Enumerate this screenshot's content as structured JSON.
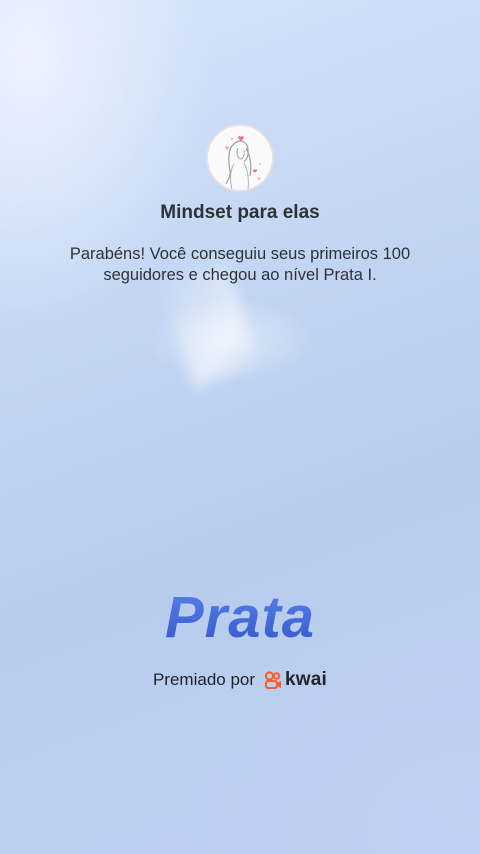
{
  "profile": {
    "name": "Mindset para elas",
    "avatar_icon": "woman-sketch-avatar-icon"
  },
  "message": "Parabéns! Você conseguiu seus primeiros 100 seguidores e chegou ao nível Prata I.",
  "level": {
    "name": "Prata",
    "color": "#3f66d6"
  },
  "awarded": {
    "label": "Premiado por",
    "brand_name": "kwai",
    "brand_icon": "kwai-logo-icon",
    "brand_color": "#ff5a1f"
  },
  "colors": {
    "background_top": "#d6e4fb",
    "background_bottom": "#bccff2",
    "text": "#2e3237"
  }
}
